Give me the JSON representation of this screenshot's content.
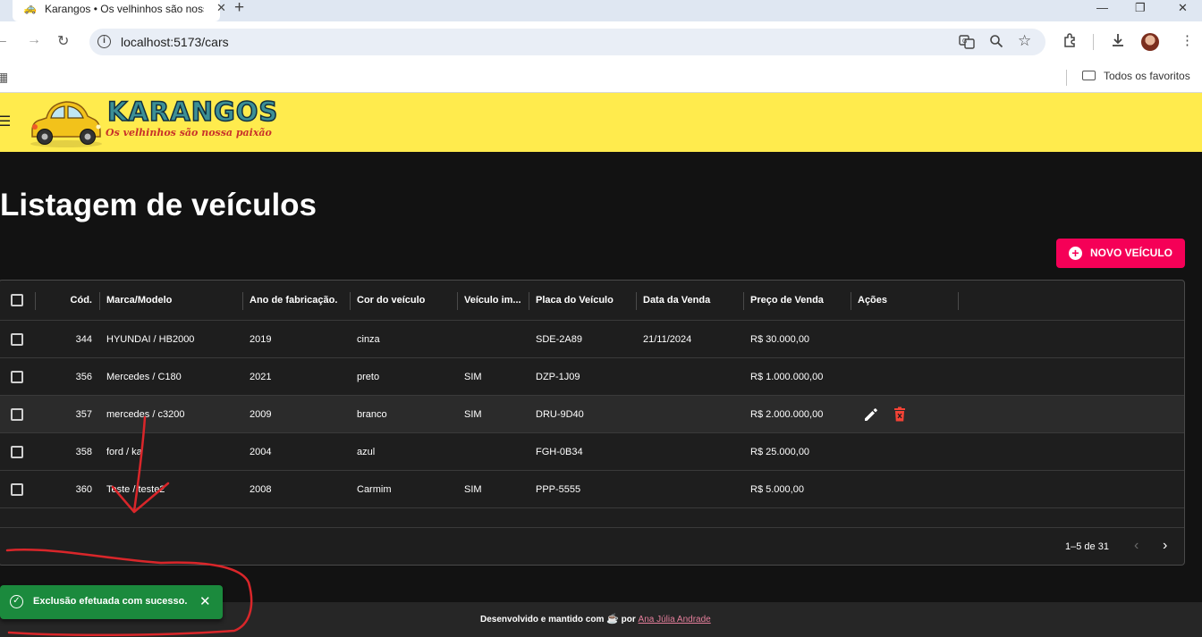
{
  "browser": {
    "tab_title": "Karangos • Os velhinhos são nossa paixão",
    "tab_close": "✕",
    "new_tab": "+",
    "window_controls": [
      "—",
      "❐",
      "✕"
    ],
    "nav": {
      "back": "←",
      "forward": "→",
      "reload": "↻"
    },
    "url": "localhost:5173/cars",
    "bookmarks_folder": "Todos os favoritos",
    "icons": [
      "translate-icon",
      "zoom-icon",
      "star-icon",
      "extensions-icon",
      "download-icon",
      "profile-avatar",
      "kebab-menu-icon",
      "apps-icon",
      "folder-icon"
    ]
  },
  "app": {
    "brand_name": "KARANGOS",
    "brand_tagline": "Os velhinhos são nossa paixão",
    "brand_color": "#ffeb4d",
    "accent_color": "#f50057"
  },
  "page": {
    "title": "Listagem de veículos",
    "new_button": "NOVO VEÍCULO"
  },
  "table": {
    "columns": [
      "Cód.",
      "Marca/Modelo",
      "Ano de fabricação.",
      "Cor do veículo",
      "Veículo im...",
      "Placa do Veículo",
      "Data da Venda",
      "Preço de Venda",
      "Ações"
    ],
    "rows": [
      {
        "id": "344",
        "model": "HYUNDAI / HB2000",
        "year": "2019",
        "color": "cinza",
        "imported": "",
        "plate": "SDE-2A89",
        "sale_date": "21/11/2024",
        "price": "R$ 30.000,00"
      },
      {
        "id": "356",
        "model": "Mercedes / C180",
        "year": "2021",
        "color": "preto",
        "imported": "SIM",
        "plate": "DZP-1J09",
        "sale_date": "",
        "price": "R$ 1.000.000,00"
      },
      {
        "id": "357",
        "model": "mercedes / c3200",
        "year": "2009",
        "color": "branco",
        "imported": "SIM",
        "plate": "DRU-9D40",
        "sale_date": "",
        "price": "R$ 2.000.000,00"
      },
      {
        "id": "358",
        "model": "ford / ka",
        "year": "2004",
        "color": "azul",
        "imported": "",
        "plate": "FGH-0B34",
        "sale_date": "",
        "price": "R$ 25.000,00"
      },
      {
        "id": "360",
        "model": "Teste / teste2",
        "year": "2008",
        "color": "Carmim",
        "imported": "SIM",
        "plate": "PPP-5555",
        "sale_date": "",
        "price": "R$ 5.000,00"
      }
    ],
    "hovered_row": 2,
    "pagination": "1–5 de 31",
    "pager_prev": "‹",
    "pager_next": "›"
  },
  "toast": {
    "message": "Exclusão efetuada com sucesso.",
    "close": "✕",
    "color": "#1b8a3d"
  },
  "footer": {
    "text": "Desenvolvido e mantido com",
    "cup": "☕",
    "by": "por",
    "author": "Ana Júlia Andrade"
  },
  "annotations": {
    "color": "#d9262a",
    "shapes": [
      "arrow-pointing-to-deleted-row",
      "circle-around-toast"
    ]
  }
}
